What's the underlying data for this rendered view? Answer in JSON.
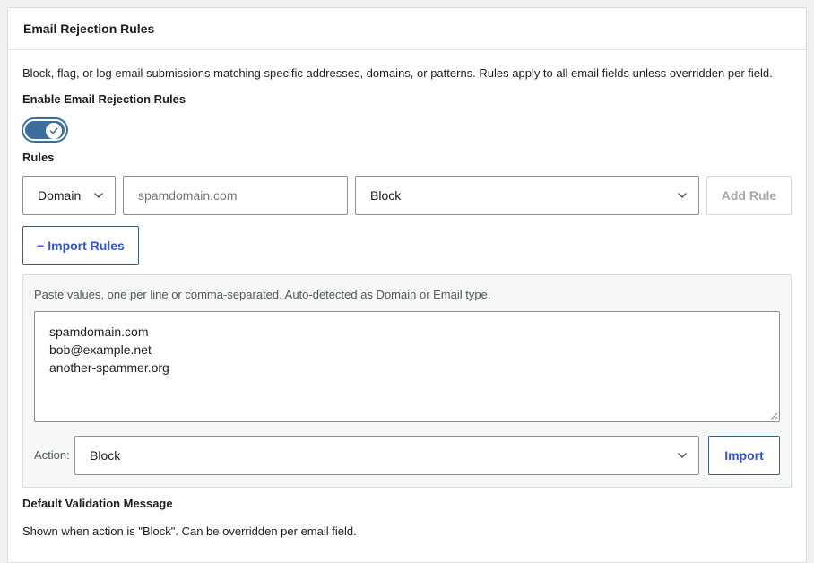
{
  "panel": {
    "title": "Email Rejection Rules",
    "description": "Block, flag, or log email submissions matching specific addresses, domains, or patterns. Rules apply to all email fields unless overridden per field."
  },
  "enable": {
    "label": "Enable Email Rejection Rules",
    "enabled": true
  },
  "rules": {
    "label": "Rules",
    "type_select": {
      "value": "Domain"
    },
    "value_input": {
      "placeholder": "spamdomain.com"
    },
    "action_select": {
      "value": "Block"
    },
    "add_button": "Add Rule",
    "import_toggle_button": "− Import Rules"
  },
  "import": {
    "hint": "Paste values, one per line or comma-separated. Auto-detected as Domain or Email type.",
    "lines": [
      "spamdomain.com",
      "bob@example.net",
      "another-spammer.org"
    ],
    "action_label": "Action:",
    "action_select": {
      "value": "Block"
    },
    "import_button": "Import"
  },
  "validation": {
    "label": "Default Validation Message",
    "note": "Shown when action is \"Block\". Can be overridden per email field."
  },
  "colors": {
    "toggle_on": "#3a6fa0",
    "link_blue": "#2f56d6"
  }
}
